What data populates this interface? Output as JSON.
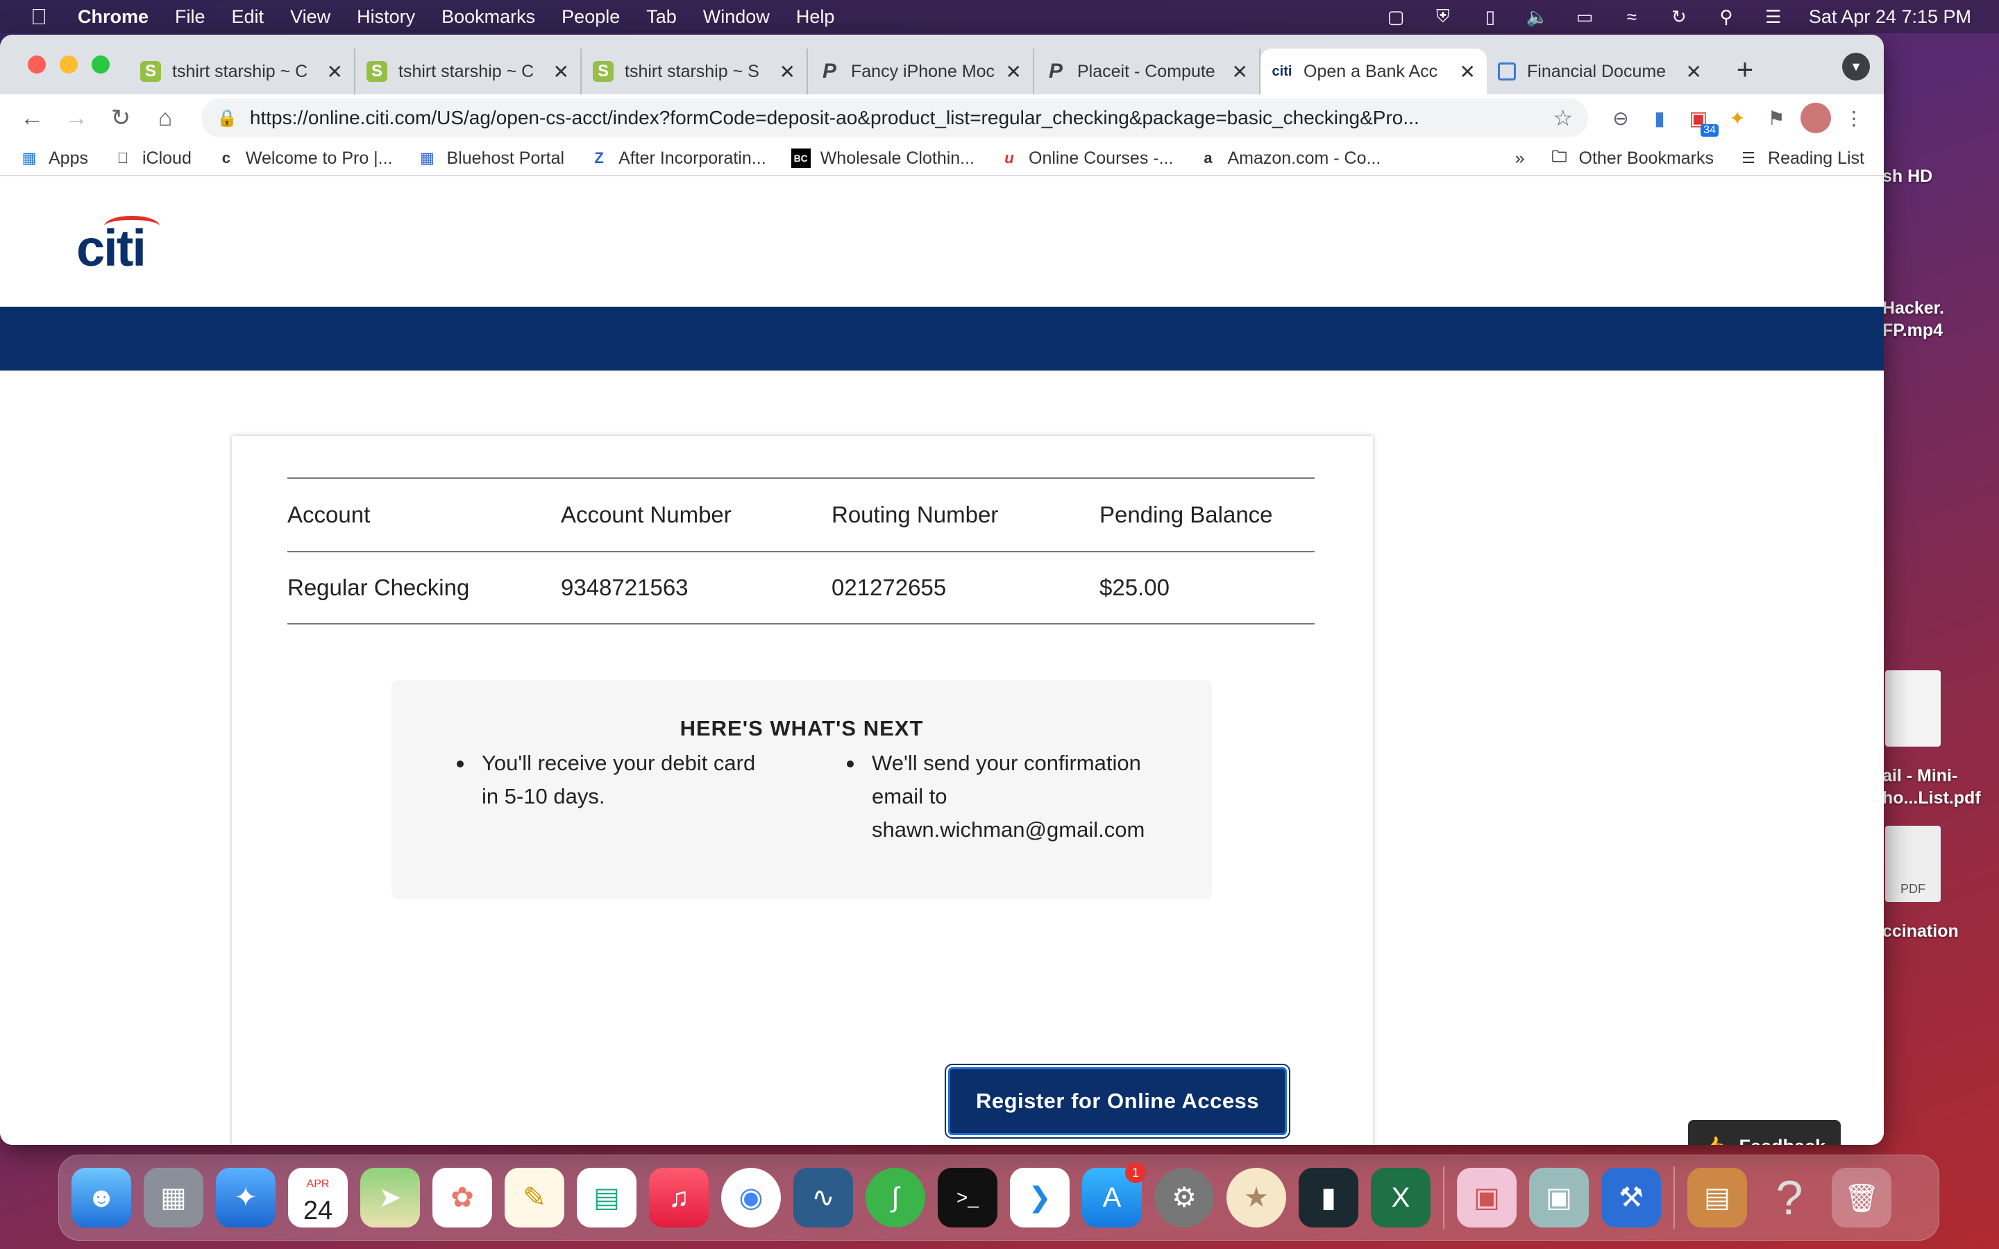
{
  "menubar": {
    "app": "Chrome",
    "items": [
      "File",
      "Edit",
      "View",
      "History",
      "Bookmarks",
      "People",
      "Tab",
      "Window",
      "Help"
    ],
    "datetime": "Sat Apr 24  7:15 PM"
  },
  "tabs": [
    {
      "title": "tshirt starship ~ C",
      "icon": "shopify-icon"
    },
    {
      "title": "tshirt starship ~ C",
      "icon": "shopify-icon"
    },
    {
      "title": "tshirt starship ~ S",
      "icon": "shopify-icon"
    },
    {
      "title": "Fancy iPhone Moc",
      "icon": "placeit-icon"
    },
    {
      "title": "Placeit - Compute",
      "icon": "placeit-icon"
    },
    {
      "title": "Open a Bank Acc",
      "icon": "citi-icon",
      "active": true
    },
    {
      "title": "Financial Docume",
      "icon": "document-icon"
    }
  ],
  "address_bar": {
    "url": "https://online.citi.com/US/ag/open-cs-acct/index?formCode=deposit-ao&product_list=regular_checking&package=basic_checking&Pro..."
  },
  "extensions": {
    "badge_count": "34"
  },
  "bookmarks": {
    "items": [
      "Apps",
      "iCloud",
      "Welcome to Pro |...",
      "Bluehost Portal",
      "After Incorporatin...",
      "Wholesale Clothin...",
      "Online Courses -...",
      "Amazon.com - Co..."
    ],
    "overflow": "»",
    "other": "Other Bookmarks",
    "reading_list": "Reading List"
  },
  "page": {
    "brand": "citi",
    "table": {
      "headers": [
        "Account",
        "Account Number",
        "Routing Number",
        "Pending Balance"
      ],
      "rows": [
        [
          "Regular Checking",
          "9348721563",
          "021272655",
          "$25.00"
        ]
      ]
    },
    "next": {
      "title": "HERE'S WHAT'S NEXT",
      "bullet1_line1": "You'll receive your debit card",
      "bullet1_line2": "in 5-10 days.",
      "bullet2_line1": "We'll send your confirmation",
      "bullet2_line2": "email to",
      "bullet2_line3": "shawn.wichman@gmail.com"
    },
    "register_label": "Register for Online Access",
    "feedback_label": "Feedback"
  },
  "desktop": {
    "labels": [
      "sh HD",
      "Hacker.",
      "FP.mp4",
      "ail - Mini-",
      "ho...List.pdf",
      "PDF",
      "ccination"
    ]
  },
  "dock": {
    "calendar_month": "APR",
    "calendar_day": "24",
    "appstore_badge": "1"
  },
  "colors": {
    "citi_navy": "#0b2f6b",
    "citi_red": "#e0302a",
    "button_focus": "#1c6ed8"
  }
}
